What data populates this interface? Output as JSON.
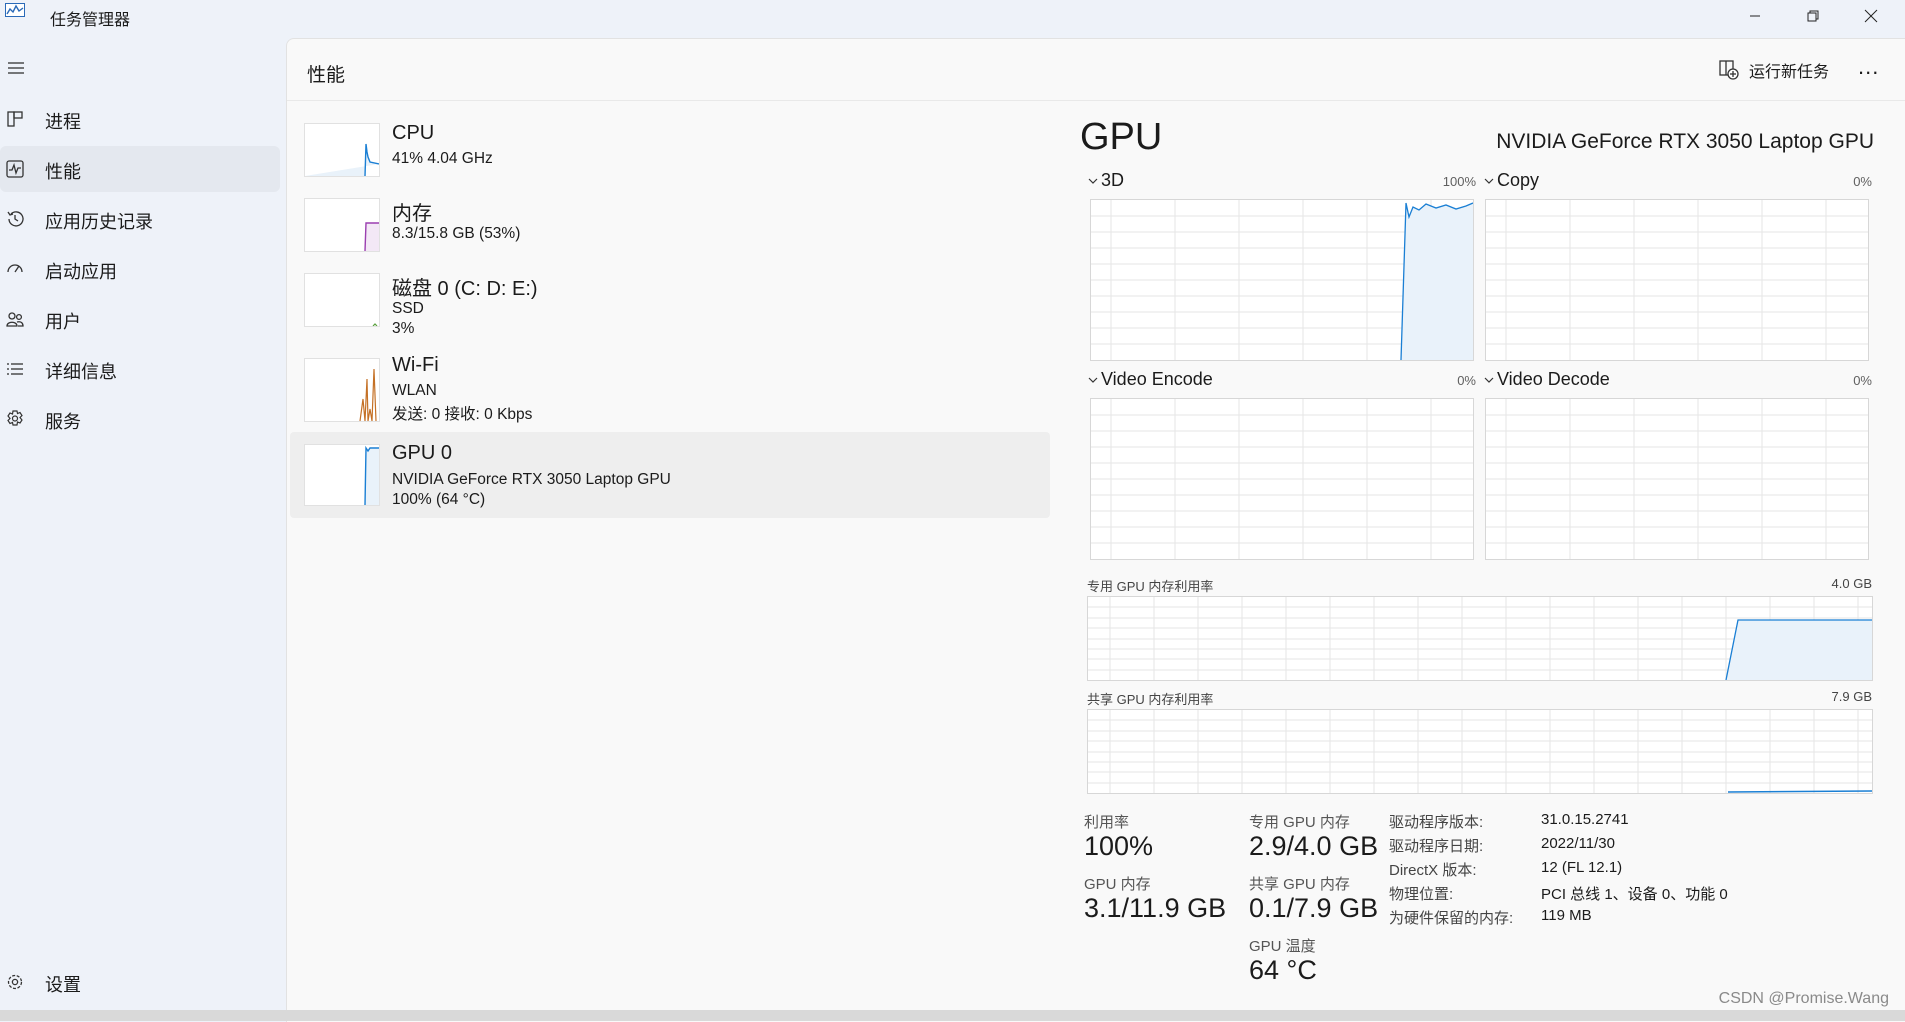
{
  "window": {
    "title": "任务管理器",
    "controls": [
      "minimize-icon",
      "restore-icon",
      "close-icon"
    ]
  },
  "sidebar": {
    "items": [
      {
        "label": "进程",
        "icon": "processes-icon"
      },
      {
        "label": "性能",
        "icon": "performance-icon"
      },
      {
        "label": "应用历史记录",
        "icon": "history-icon"
      },
      {
        "label": "启动应用",
        "icon": "startup-icon"
      },
      {
        "label": "用户",
        "icon": "users-icon"
      },
      {
        "label": "详细信息",
        "icon": "details-icon"
      },
      {
        "label": "服务",
        "icon": "services-icon"
      }
    ],
    "selected": "性能",
    "settings_label": "设置"
  },
  "header": {
    "title": "性能",
    "run_task_label": "运行新任务",
    "more": "..."
  },
  "devices": [
    {
      "name": "CPU",
      "line1": "41% 4.04 GHz",
      "line2": "",
      "color": "#1a7fd4",
      "level": 0.41
    },
    {
      "name": "内存",
      "line1": "8.3/15.8 GB (53%)",
      "line2": "",
      "color": "#9b3fb0",
      "level": 0.53
    },
    {
      "name": "磁盘 0 (C: D: E:)",
      "line1": "SSD",
      "line2": "3%",
      "color": "#58a03c",
      "level": 0.03
    },
    {
      "name": "Wi-Fi",
      "line1": "WLAN",
      "line2": "发送: 0 接收: 0 Kbps",
      "color": "#c47025",
      "level": 0.0
    },
    {
      "name": "GPU 0",
      "line1": "NVIDIA GeForce RTX 3050 Laptop GPU",
      "line2": "100% (64 °C)",
      "color": "#1a7fd4",
      "level": 1.0
    }
  ],
  "gpu": {
    "heading": "GPU",
    "model": "NVIDIA GeForce RTX 3050 Laptop GPU",
    "engines": [
      {
        "name": "3D",
        "percent": "100%"
      },
      {
        "name": "Copy",
        "percent": "0%"
      },
      {
        "name": "Video Encode",
        "percent": "0%"
      },
      {
        "name": "Video Decode",
        "percent": "0%"
      }
    ],
    "dedicated_label": "专用 GPU 内存利用率",
    "dedicated_max": "4.0 GB",
    "shared_label": "共享 GPU 内存利用率",
    "shared_max": "7.9 GB",
    "stats": {
      "util_label": "利用率",
      "util_value": "100%",
      "dedicated_mem_label": "专用 GPU 内存",
      "dedicated_mem_value": "2.9/4.0 GB",
      "gpu_mem_label": "GPU 内存",
      "gpu_mem_value": "3.1/11.9 GB",
      "shared_mem_label": "共享 GPU 内存",
      "shared_mem_value": "0.1/7.9 GB",
      "temp_label": "GPU 温度",
      "temp_value": "64 °C"
    },
    "info": [
      {
        "label": "驱动程序版本:",
        "value": "31.0.15.2741"
      },
      {
        "label": "驱动程序日期:",
        "value": "2022/11/30"
      },
      {
        "label": "DirectX 版本:",
        "value": "12 (FL 12.1)"
      },
      {
        "label": "物理位置:",
        "value": "PCI 总线 1、设备 0、功能 0"
      },
      {
        "label": "为硬件保留的内存:",
        "value": "119 MB"
      }
    ]
  },
  "watermark": "CSDN @Promise.Wang",
  "colors": {
    "accent": "#1a7fd4",
    "graph_fill": "#e9f2fa",
    "grid": "#e6e6e6"
  }
}
